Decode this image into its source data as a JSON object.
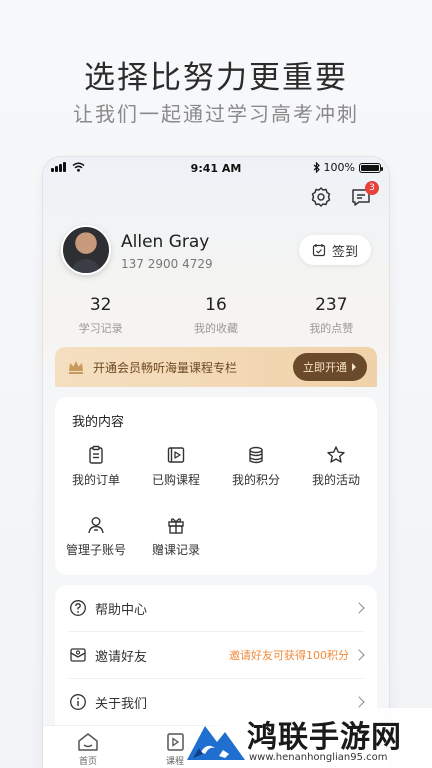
{
  "hero": {
    "title": "选择比努力更重要",
    "subtitle": "让我们一起通过学习高考冲刺"
  },
  "status_bar": {
    "time": "9:41 AM",
    "battery": "100%"
  },
  "header": {
    "message_badge": "3"
  },
  "profile": {
    "name": "Allen Gray",
    "phone": "137 2900 4729",
    "checkin_label": "签到"
  },
  "stats": [
    {
      "value": "32",
      "label": "学习记录"
    },
    {
      "value": "16",
      "label": "我的收藏"
    },
    {
      "value": "237",
      "label": "我的点赞"
    }
  ],
  "vip_banner": {
    "text": "开通会员畅听海量课程专栏",
    "button": "立即开通"
  },
  "my_content": {
    "title": "我的内容",
    "items": [
      {
        "label": "我的订单",
        "icon": "clipboard-icon"
      },
      {
        "label": "已购课程",
        "icon": "play-book-icon"
      },
      {
        "label": "我的积分",
        "icon": "coins-icon"
      },
      {
        "label": "我的活动",
        "icon": "star-icon"
      },
      {
        "label": "管理子账号",
        "icon": "user-manage-icon"
      },
      {
        "label": "赠课记录",
        "icon": "gift-icon"
      }
    ]
  },
  "menu": [
    {
      "label": "帮助中心",
      "extra": "",
      "icon": "help-icon"
    },
    {
      "label": "邀请好友",
      "extra": "邀请好友可获得100积分",
      "icon": "invite-icon"
    },
    {
      "label": "关于我们",
      "extra": "",
      "icon": "info-icon"
    }
  ],
  "tabs": [
    {
      "label": "首页",
      "icon": "home-icon"
    },
    {
      "label": "课程",
      "icon": "course-icon"
    }
  ],
  "watermark": {
    "title": "鸿联手游网",
    "url": "www.henanhonglian95.com"
  },
  "colors": {
    "accent_orange": "#f08a3c",
    "vip_brown": "#6b4a2c",
    "badge_red": "#e8413c"
  }
}
